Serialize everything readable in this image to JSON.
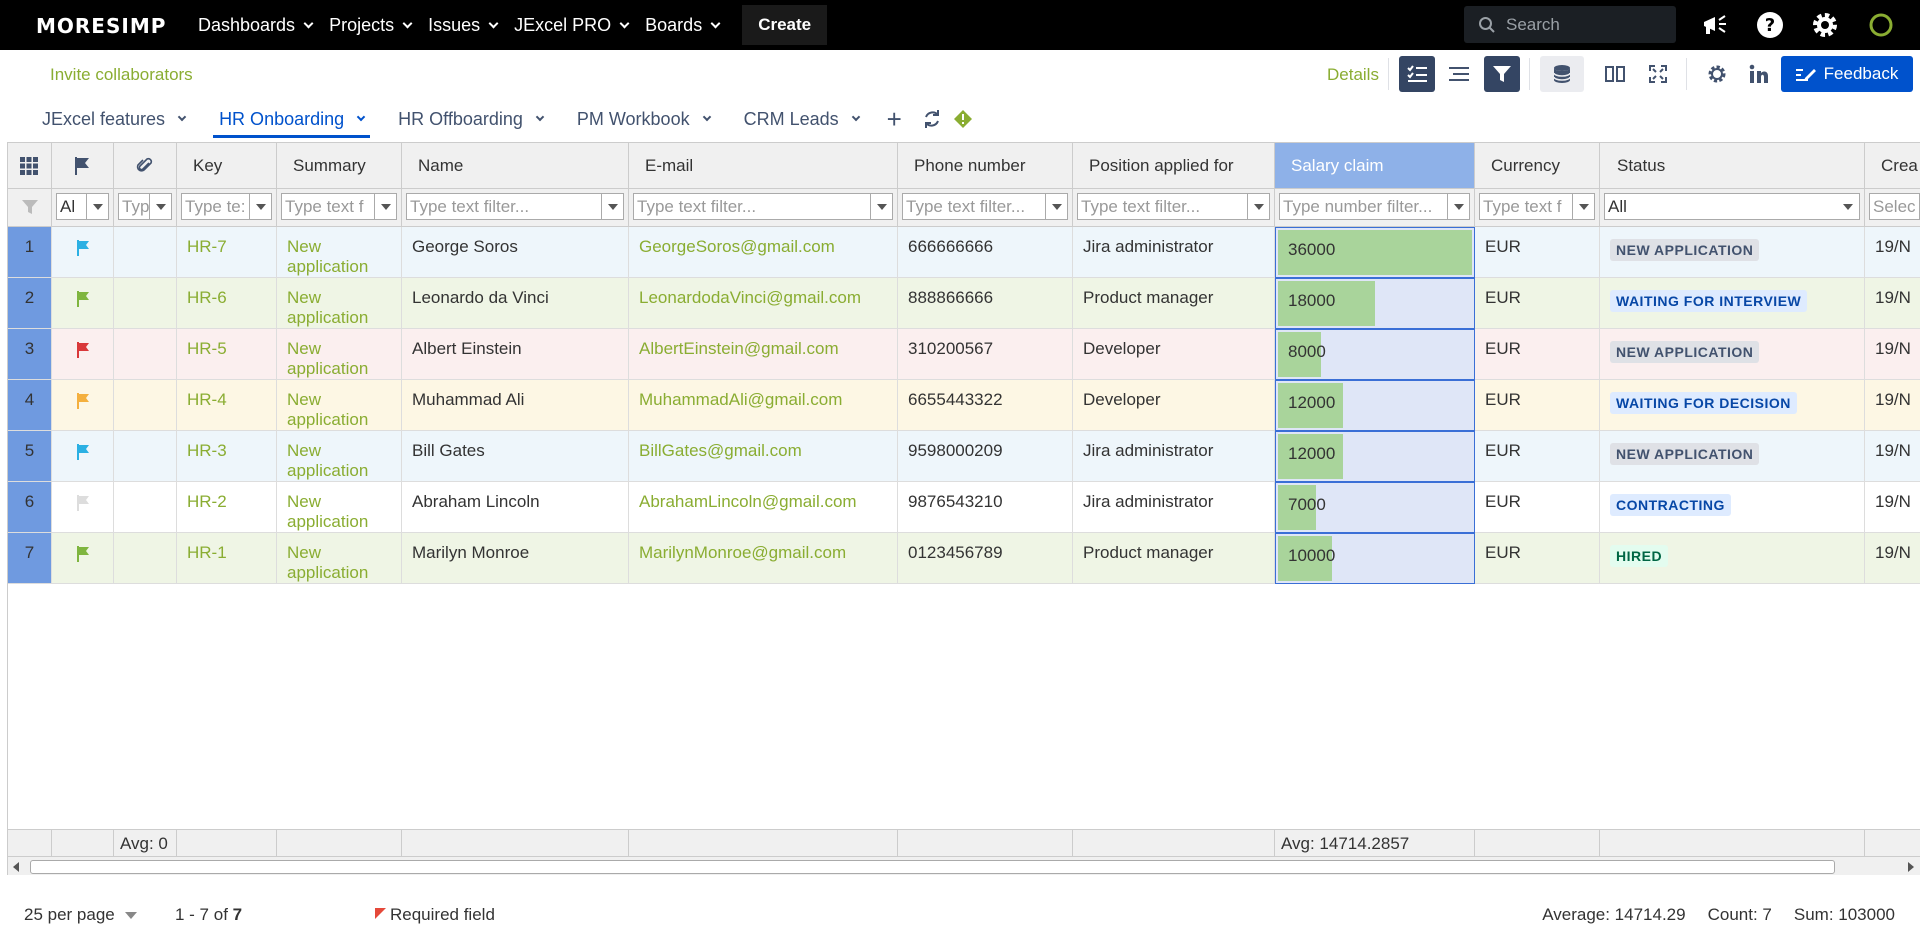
{
  "topnav": {
    "logo": "MORESIMP",
    "items": [
      "Dashboards",
      "Projects",
      "Issues",
      "JExcel PRO",
      "Boards"
    ],
    "create": "Create",
    "search_placeholder": "Search"
  },
  "toolbar": {
    "invite": "Invite collaborators",
    "details": "Details",
    "feedback": "Feedback"
  },
  "tabs": [
    "JExcel features",
    "HR Onboarding",
    "HR Offboarding",
    "PM Workbook",
    "CRM Leads"
  ],
  "active_tab": "HR Onboarding",
  "columns": [
    "",
    "",
    "",
    "Key",
    "Summary",
    "Name",
    "E-mail",
    "Phone number",
    "Position applied for",
    "Salary claim",
    "Currency",
    "Status",
    "Crea"
  ],
  "filters": {
    "flag": "Al",
    "attach": "Typ",
    "key": "Type te:",
    "summary": "Type text f",
    "name": "Type text filter...",
    "email": "Type text filter...",
    "phone": "Type text filter...",
    "position": "Type text filter...",
    "salary": "Type number filter...",
    "currency": "Type text f",
    "status": "All",
    "created": "Selec"
  },
  "rows": [
    {
      "n": "1",
      "flag": "#2bb0e3",
      "key": "HR-7",
      "summary": "New application",
      "name": "George Soros",
      "email": "GeorgeSoros@gmail.com",
      "phone": "666666666",
      "position": "Jira administrator",
      "salary": "36000",
      "salary_value": 36000,
      "currency": "EUR",
      "status": "NEW APPLICATION",
      "status_style": "gray",
      "created": "19/N",
      "bg": "#eef6fb"
    },
    {
      "n": "2",
      "flag": "#7fb53f",
      "key": "HR-6",
      "summary": "New application",
      "name": "Leonardo da Vinci",
      "email": "LeonardodaVinci@gmail.com",
      "phone": "888866666",
      "position": "Product manager",
      "salary": "18000",
      "salary_value": 18000,
      "currency": "EUR",
      "status": "WAITING FOR INTERVIEW",
      "status_style": "blue",
      "created": "19/N",
      "bg": "#eff5e5"
    },
    {
      "n": "3",
      "flag": "#d9383a",
      "key": "HR-5",
      "summary": "New application",
      "name": "Albert Einstein",
      "email": "AlbertEinstein@gmail.com",
      "phone": "310200567",
      "position": "Developer",
      "salary": "8000",
      "salary_value": 8000,
      "currency": "EUR",
      "status": "NEW APPLICATION",
      "status_style": "gray",
      "created": "19/N",
      "bg": "#fbefef"
    },
    {
      "n": "4",
      "flag": "#f4b03e",
      "key": "HR-4",
      "summary": "New application",
      "name": "Muhammad Ali",
      "email": "MuhammadAli@gmail.com",
      "phone": "6655443322",
      "position": "Developer",
      "salary": "12000",
      "salary_value": 12000,
      "currency": "EUR",
      "status": "WAITING FOR DECISION",
      "status_style": "blue",
      "created": "19/N",
      "bg": "#fdf7e4"
    },
    {
      "n": "5",
      "flag": "#2bb0e3",
      "key": "HR-3",
      "summary": "New application",
      "name": "Bill Gates",
      "email": "BillGates@gmail.com",
      "phone": "9598000209",
      "position": "Jira administrator",
      "salary": "12000",
      "salary_value": 12000,
      "currency": "EUR",
      "status": "NEW APPLICATION",
      "status_style": "gray",
      "created": "19/N",
      "bg": "#eef6fb"
    },
    {
      "n": "6",
      "flag": "#dddddd",
      "key": "HR-2",
      "summary": "New application",
      "name": "Abraham Lincoln",
      "email": "AbrahamLincoln@gmail.com",
      "phone": "9876543210",
      "position": "Jira administrator",
      "salary": "7000",
      "salary_value": 7000,
      "currency": "EUR",
      "status": "CONTRACTING",
      "status_style": "blue",
      "created": "19/N",
      "bg": "#ffffff"
    },
    {
      "n": "7",
      "flag": "#7fb53f",
      "key": "HR-1",
      "summary": "New application",
      "name": "Marilyn Monroe",
      "email": "MarilynMonroe@gmail.com",
      "phone": "0123456789",
      "position": "Product manager",
      "salary": "10000",
      "salary_value": 10000,
      "currency": "EUR",
      "status": "HIRED",
      "status_style": "green",
      "created": "19/N",
      "bg": "#eff5e5"
    }
  ],
  "salary_max": 36000,
  "avg_row": {
    "attach": "Avg: 0",
    "salary": "Avg: 14714.2857"
  },
  "footer": {
    "per_page": "25 per page",
    "range": "1 - 7 of",
    "total": "7",
    "required": "Required field",
    "average": "Average: 14714.29",
    "count": "Count: 7",
    "sum": "Sum: 103000"
  },
  "colors": {
    "accent": "#0052cc",
    "link": "#8aad32",
    "selected_header": "#8eb1e8",
    "row_number": "#6f9ae0"
  }
}
